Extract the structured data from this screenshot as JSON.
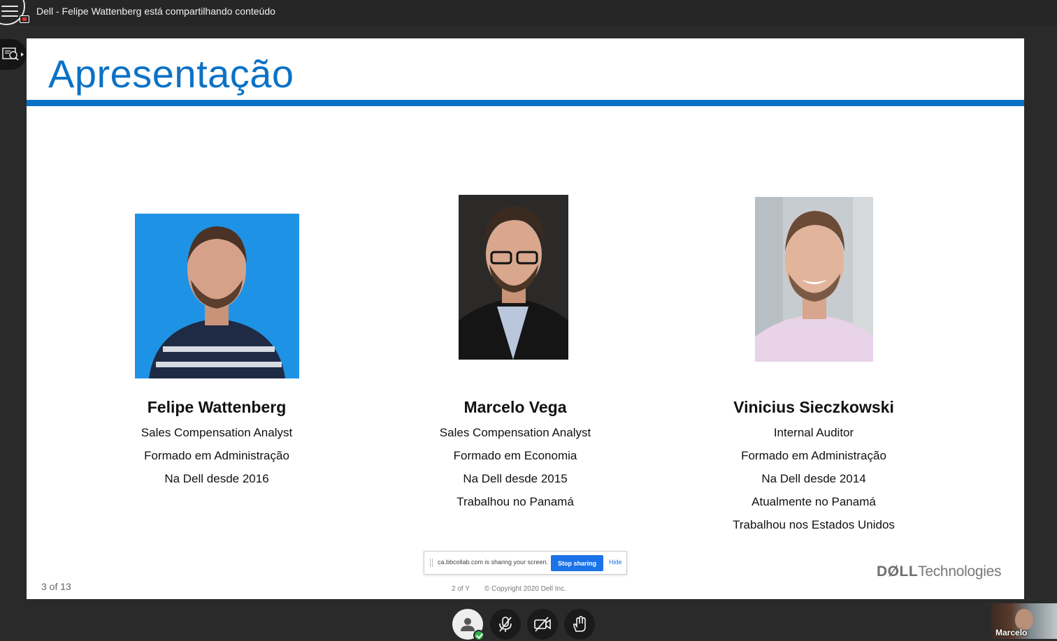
{
  "window": {
    "title": "Dell - Felipe Wattenberg está compartilhando conteúdo"
  },
  "slide": {
    "title": "Apresentação",
    "slide_number": "3 of 13",
    "people": [
      {
        "name": "Felipe Wattenberg",
        "lines": [
          "Sales Compensation Analyst",
          "Formado em Administração",
          "Na Dell desde 2016"
        ]
      },
      {
        "name": "Marcelo Vega",
        "lines": [
          "Sales Compensation Analyst",
          "Formado em Economia",
          "Na Dell desde 2015",
          "Trabalhou no Panamá"
        ]
      },
      {
        "name": "Vinicius Sieczkowski",
        "lines": [
          "Internal Auditor",
          "Formado em Administração",
          "Na Dell desde 2014",
          "Atualmente no Panamá",
          "Trabalhou nos Estados Unidos"
        ]
      }
    ],
    "footer": {
      "page": "2 of Y",
      "copyright": "© Copyright 2020 Dell Inc.",
      "logo_bold": "DØLL",
      "logo_text": "Technologies"
    }
  },
  "share_bar": {
    "message": "ca.bbcollab.com is sharing your screen.",
    "stop_label": "Stop sharing",
    "hide_label": "Hide"
  },
  "self_view": {
    "name": "Marcelo"
  },
  "colors": {
    "accent": "#0a72c6",
    "topbar": "#262626",
    "status_ok": "#2db34a"
  }
}
